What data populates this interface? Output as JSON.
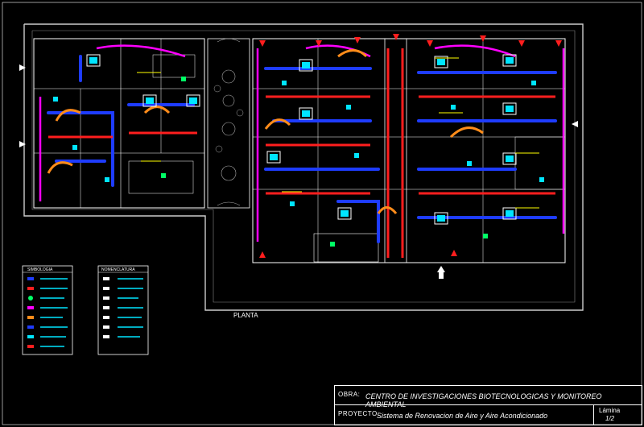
{
  "drawing": {
    "plan_label": "PLANTA",
    "legend_left_title": "SIMBOLOGIA",
    "legend_right_title": "NOMENCLATURA"
  },
  "title_block": {
    "obra_label": "OBRA:",
    "obra_value": "CENTRO DE INVESTIGACIONES BIOTECNOLOGICAS Y MONITOREO AMBIENTAL",
    "proyecto_label": "PROYECTO:",
    "proyecto_value": "Sistema de Renovacion de Aire y Aire Acondicionado",
    "sheet_label": "Lámina",
    "sheet_value": "1/2"
  },
  "colors": {
    "background": "#000000",
    "walls": "#ffffff",
    "supply_duct": "#1e3cff",
    "return_duct": "#ff1e1e",
    "exhaust": "#ff00ff",
    "equipment": "#00e5ff",
    "hatch": "#ff8c1a",
    "labels": "#ffff00",
    "vents": "#00ff66"
  }
}
